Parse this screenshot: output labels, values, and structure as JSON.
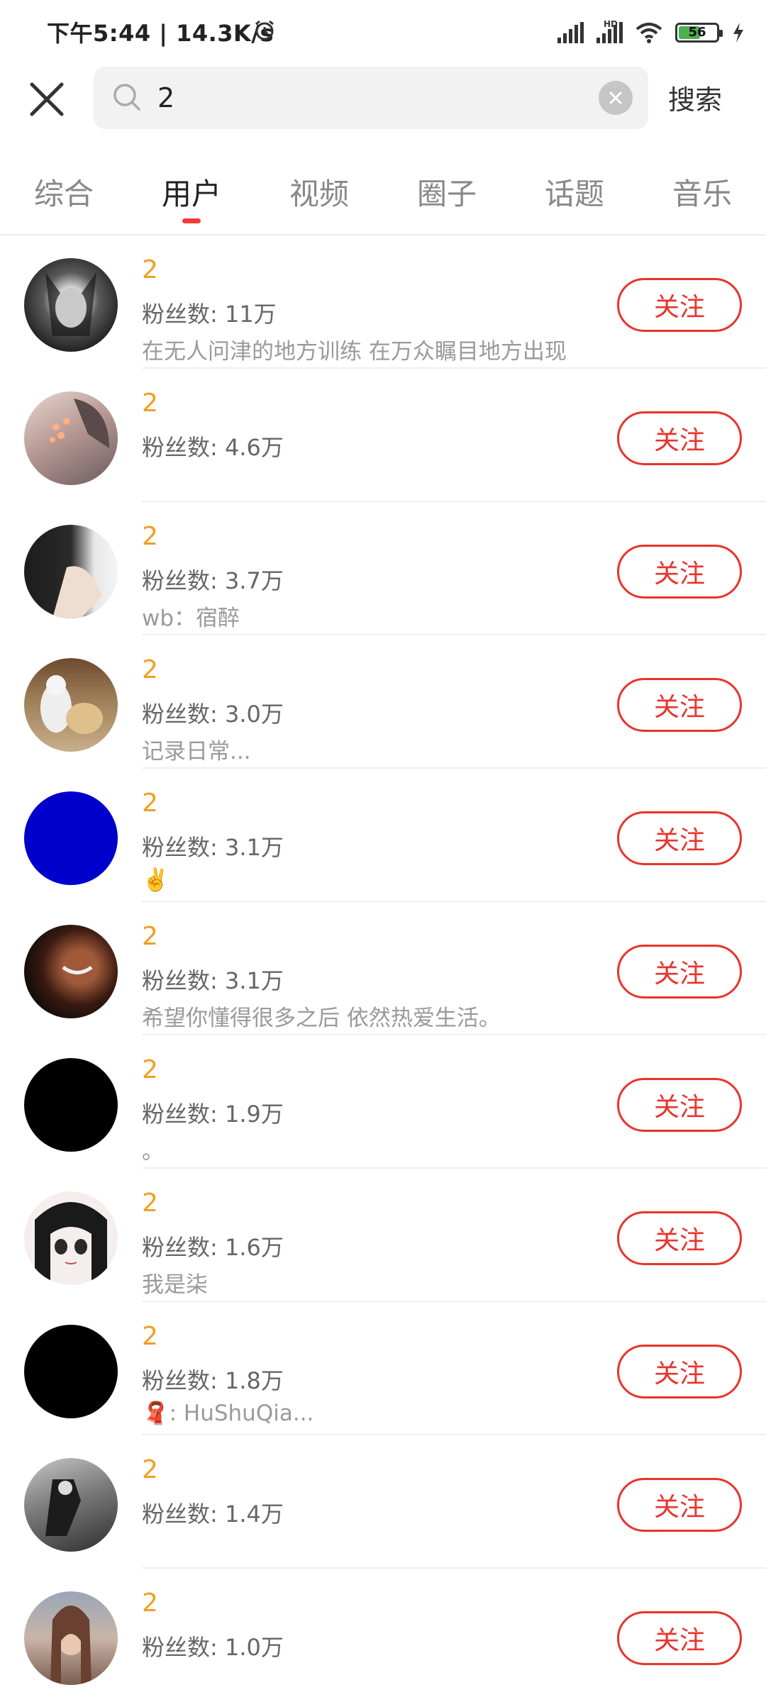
{
  "status_bar": {
    "time": "下午5:44 | 14.3K/s",
    "hd": "HD",
    "battery": "56"
  },
  "search": {
    "value": "2",
    "submit_label": "搜索"
  },
  "tabs": [
    {
      "label": "综合"
    },
    {
      "label": "用户"
    },
    {
      "label": "视频"
    },
    {
      "label": "圈子"
    },
    {
      "label": "话题"
    },
    {
      "label": "音乐"
    }
  ],
  "active_tab": "用户",
  "follow_label": "关注",
  "users": [
    {
      "name": "2",
      "fans": "粉丝数: 11万",
      "bio": "在无人问津的地方训练 在万众瞩目地方出现"
    },
    {
      "name": "2",
      "fans": "粉丝数: 4.6万",
      "bio": ""
    },
    {
      "name": "2",
      "fans": "粉丝数: 3.7万",
      "bio": "wb：宿醉"
    },
    {
      "name": "2",
      "fans": "粉丝数: 3.0万",
      "bio": "记录日常..."
    },
    {
      "name": "2",
      "fans": "粉丝数: 3.1万",
      "bio": "✌️"
    },
    {
      "name": "2",
      "fans": "粉丝数: 3.1万",
      "bio": "希望你懂得很多之后 依然热爱生活。"
    },
    {
      "name": "2",
      "fans": "粉丝数: 1.9万",
      "bio": "。"
    },
    {
      "name": "2",
      "fans": "粉丝数: 1.6万",
      "bio": "我是柒"
    },
    {
      "name": "2",
      "fans": "粉丝数: 1.8万",
      "bio": "🧣: HuShuQia..."
    },
    {
      "name": "2",
      "fans": "粉丝数: 1.4万",
      "bio": ""
    },
    {
      "name": "2",
      "fans": "粉丝数: 1.0万",
      "bio": ""
    }
  ],
  "colors": {
    "accent_red": "#e8342b",
    "name_orange": "#f0a020",
    "tab_indicator": "#f23a3a"
  }
}
